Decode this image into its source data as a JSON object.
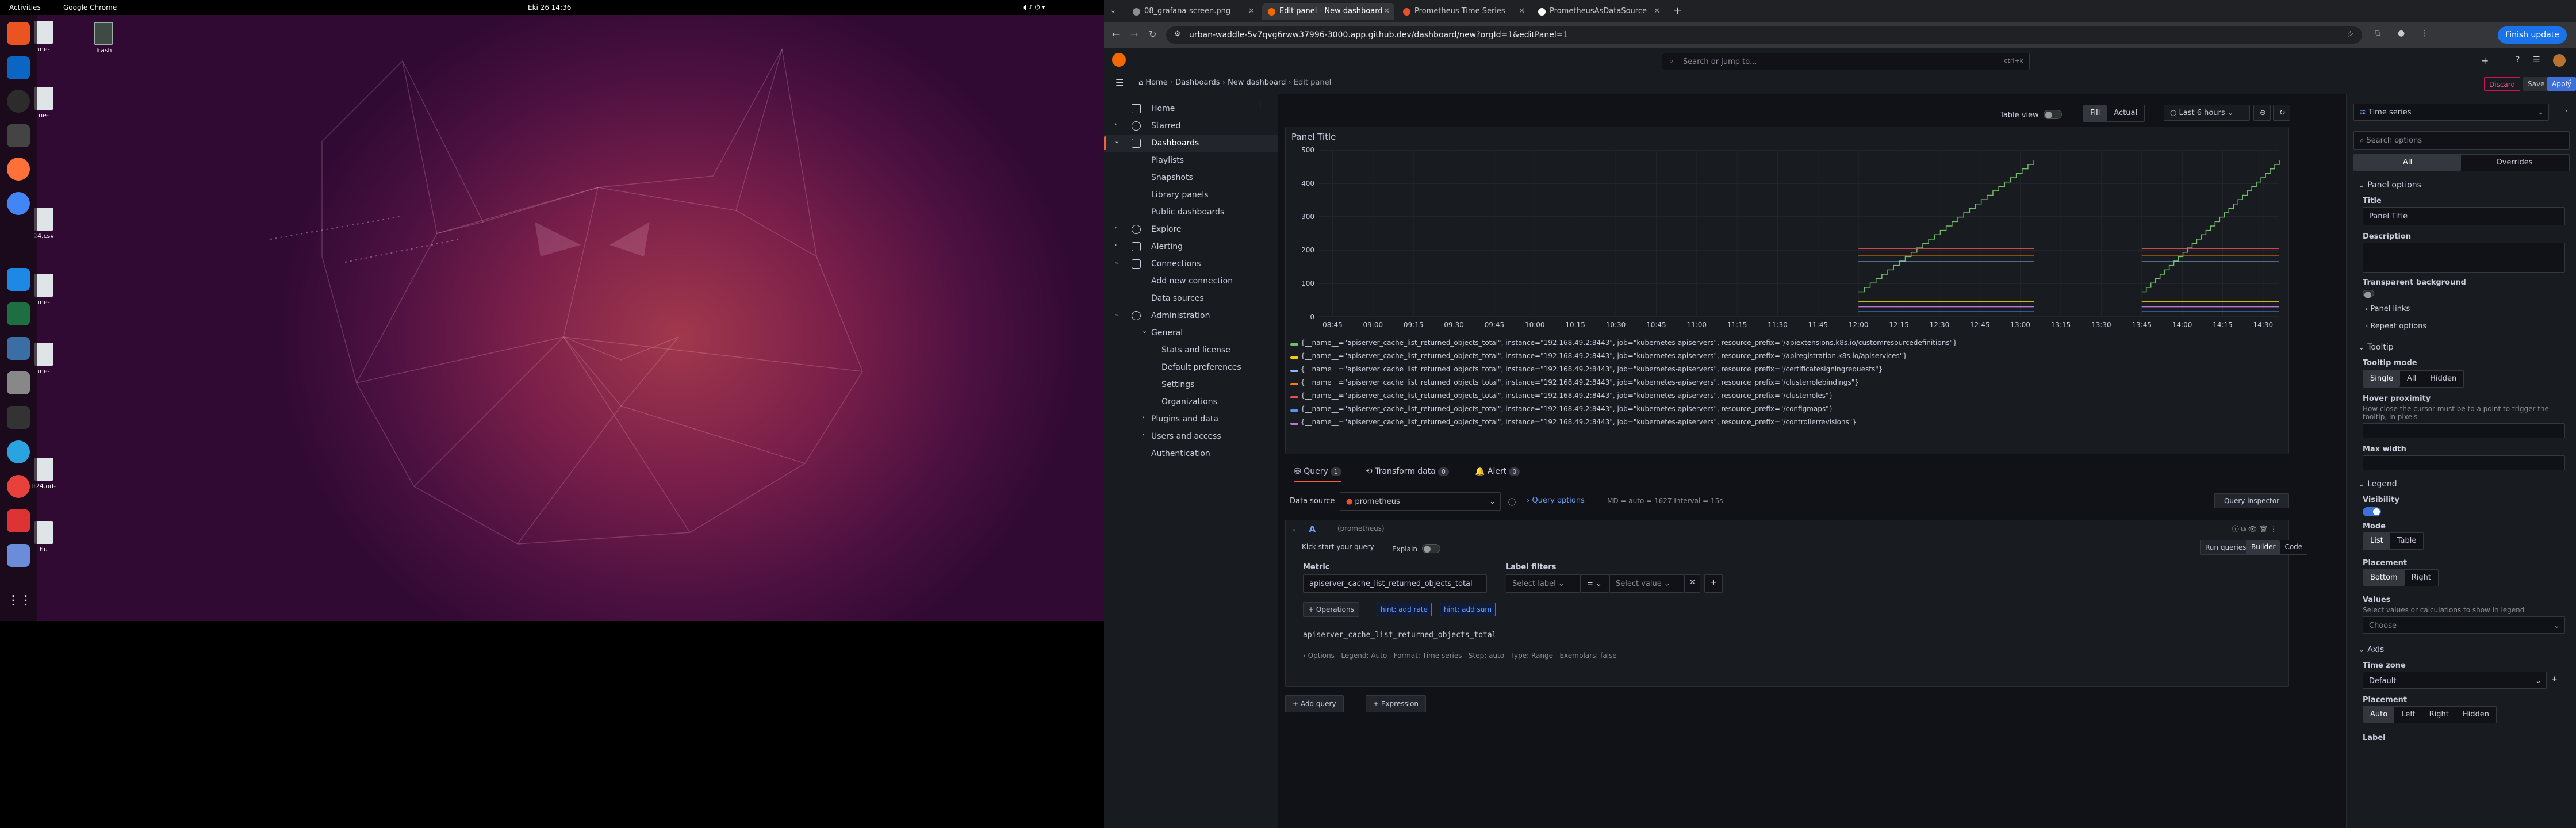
{
  "desktop": {
    "activities": "Activities",
    "app_menu": "Google Chrome",
    "clock": "Eki 26  14:36",
    "trash_label": "Trash",
    "desk_icons": [
      "me-",
      "ne-",
      "24.csv",
      "me-",
      "me-",
      "024.od-",
      "flu"
    ]
  },
  "browser": {
    "tabs": [
      {
        "label": "08_grafana-screen.png",
        "active": false,
        "color": "#8e8e8e"
      },
      {
        "label": "Edit panel - New dashboard",
        "active": true,
        "color": "#f46800"
      },
      {
        "label": "Prometheus Time Series",
        "active": false,
        "color": "#e6522c"
      },
      {
        "label": "PrometheusAsDataSource",
        "active": false,
        "color": "#ffffff"
      }
    ],
    "url": "urban-waddle-5v7qvg6rww37996-3000.app.github.dev/dashboard/new?orgId=1&editPanel=1",
    "finish_update": "Finish update"
  },
  "grafana": {
    "search_placeholder": "Search or jump to...",
    "search_shortcut": "ctrl+k",
    "breadcrumb": [
      "Home",
      "Dashboards",
      "New dashboard",
      "Edit panel"
    ],
    "discard": "Discard",
    "save": "Save",
    "apply": "Apply",
    "nav": [
      {
        "label": "Home",
        "level": 0
      },
      {
        "label": "Starred",
        "level": 0
      },
      {
        "label": "Dashboards",
        "level": 0,
        "active": true
      },
      {
        "label": "Playlists",
        "level": 1
      },
      {
        "label": "Snapshots",
        "level": 1
      },
      {
        "label": "Library panels",
        "level": 1
      },
      {
        "label": "Public dashboards",
        "level": 1
      },
      {
        "label": "Explore",
        "level": 0
      },
      {
        "label": "Alerting",
        "level": 0
      },
      {
        "label": "Connections",
        "level": 0
      },
      {
        "label": "Add new connection",
        "level": 1
      },
      {
        "label": "Data sources",
        "level": 1
      },
      {
        "label": "Administration",
        "level": 0
      },
      {
        "label": "General",
        "level": 1
      },
      {
        "label": "Stats and license",
        "level": 2
      },
      {
        "label": "Default preferences",
        "level": 2
      },
      {
        "label": "Settings",
        "level": 2
      },
      {
        "label": "Organizations",
        "level": 2
      },
      {
        "label": "Plugins and data",
        "level": 1
      },
      {
        "label": "Users and access",
        "level": 1
      },
      {
        "label": "Authentication",
        "level": 1
      }
    ],
    "panel_toolbar": {
      "table_view": "Table view",
      "fill": "Fill",
      "actual": "Actual",
      "time_range": "Last 6 hours"
    },
    "panel_title": "Panel Title",
    "legend_items": [
      {
        "text": "{__name__=\"apiserver_cache_list_returned_objects_total\", instance=\"192.168.49.2:8443\", job=\"kubernetes-apiservers\", resource_prefix=\"/apiextensions.k8s.io/customresourcedefinitions\"}",
        "color": "#73bf69"
      },
      {
        "text": "{__name__=\"apiserver_cache_list_returned_objects_total\", instance=\"192.168.49.2:8443\", job=\"kubernetes-apiservers\", resource_prefix=\"/apiregistration.k8s.io/apiservices\"}",
        "color": "#f2cc0c"
      },
      {
        "text": "{__name__=\"apiserver_cache_list_returned_objects_total\", instance=\"192.168.49.2:8443\", job=\"kubernetes-apiservers\", resource_prefix=\"/certificatesigningrequests\"}",
        "color": "#8ab8ff"
      },
      {
        "text": "{__name__=\"apiserver_cache_list_returned_objects_total\", instance=\"192.168.49.2:8443\", job=\"kubernetes-apiservers\", resource_prefix=\"/clusterrolebindings\"}",
        "color": "#ff780a"
      },
      {
        "text": "{__name__=\"apiserver_cache_list_returned_objects_total\", instance=\"192.168.49.2:8443\", job=\"kubernetes-apiservers\", resource_prefix=\"/clusterroles\"}",
        "color": "#f2495c"
      },
      {
        "text": "{__name__=\"apiserver_cache_list_returned_objects_total\", instance=\"192.168.49.2:8443\", job=\"kubernetes-apiservers\", resource_prefix=\"/configmaps\"}",
        "color": "#5794f2"
      },
      {
        "text": "{__name__=\"apiserver_cache_list_returned_objects_total\", instance=\"192.168.49.2:8443\", job=\"kubernetes-apiservers\", resource_prefix=\"/controllerrevisions\"}",
        "color": "#b877d9"
      }
    ],
    "query_tabs": [
      {
        "label": "Query",
        "count": "1"
      },
      {
        "label": "Transform data",
        "count": "0"
      },
      {
        "label": "Alert",
        "count": "0"
      }
    ],
    "data_source_label": "Data source",
    "data_source": "prometheus",
    "query_options": "Query options",
    "query_meta": "MD = auto = 1627    Interval = 15s",
    "query_inspector": "Query inspector",
    "query_ref": "A",
    "query_ds": "(prometheus)",
    "kick_start": "Kick start your query",
    "explain": "Explain",
    "run_queries": "Run queries",
    "builder": "Builder",
    "code": "Code",
    "metric_label": "Metric",
    "metric_value": "apiserver_cache_list_returned_objects_total",
    "label_filters": "Label filters",
    "select_label": "Select label",
    "operator": "=",
    "select_value": "Select value",
    "operations": "Operations",
    "hint_rate": "hint: add rate",
    "hint_sum": "hint: add sum",
    "query_text": "apiserver_cache_list_returned_objects_total",
    "options_summary": "Options   Legend: Auto   Format: Time series   Step: auto   Type: Range   Exemplars: false",
    "add_query": "Add query",
    "expression": "Expression"
  },
  "options_pane": {
    "viz": "Time series",
    "search_placeholder": "Search options",
    "all": "All",
    "overrides": "Overrides",
    "panel_options": "Panel options",
    "title_label": "Title",
    "title_value": "Panel Title",
    "description_label": "Description",
    "transparent_label": "Transparent background",
    "panel_links": "Panel links",
    "repeat_options": "Repeat options",
    "tooltip": "Tooltip",
    "tooltip_mode": "Tooltip mode",
    "tooltip_modes": [
      "Single",
      "All",
      "Hidden"
    ],
    "hover_proximity": "Hover proximity",
    "hover_desc": "How close the cursor must be to a point to trigger the tooltip, in pixels",
    "max_width": "Max width",
    "legend": "Legend",
    "visibility": "Visibility",
    "mode": "Mode",
    "modes": [
      "List",
      "Table"
    ],
    "placement": "Placement",
    "placements": [
      "Bottom",
      "Right"
    ],
    "values": "Values",
    "values_desc": "Select values or calculations to show in legend",
    "values_choose": "Choose",
    "axis": "Axis",
    "time_zone": "Time zone",
    "time_zone_value": "Default",
    "axis_placement": "Placement",
    "axis_placements": [
      "Auto",
      "Left",
      "Right",
      "Hidden"
    ],
    "label": "Label"
  },
  "chart_data": {
    "type": "line",
    "title": "Panel Title",
    "x_ticks": [
      "08:45",
      "09:00",
      "09:15",
      "09:30",
      "09:45",
      "10:00",
      "10:15",
      "10:30",
      "10:45",
      "11:00",
      "11:15",
      "11:30",
      "11:45",
      "12:00",
      "12:15",
      "12:30",
      "12:45",
      "13:00",
      "13:15",
      "13:30",
      "13:45",
      "14:00",
      "14:15",
      "14:30"
    ],
    "ylim": [
      0,
      500
    ],
    "y_ticks": [
      0,
      100,
      200,
      300,
      400,
      500
    ],
    "segments": [
      {
        "x_start": "12:00",
        "x_end": "13:05"
      },
      {
        "x_start": "13:45",
        "x_end": "14:36"
      }
    ],
    "series": [
      {
        "color": "#73bf69",
        "values_start": 75,
        "values_end": 470,
        "kind": "ramp"
      },
      {
        "color": "#f2495c",
        "value": 205
      },
      {
        "color": "#ff780a",
        "value": 185
      },
      {
        "color": "#8ab8ff",
        "value": 165
      },
      {
        "color": "#f2cc0c",
        "value": 45
      },
      {
        "color": "#b877d9",
        "value": 30
      },
      {
        "color": "#5794f2",
        "value": 15
      }
    ]
  }
}
